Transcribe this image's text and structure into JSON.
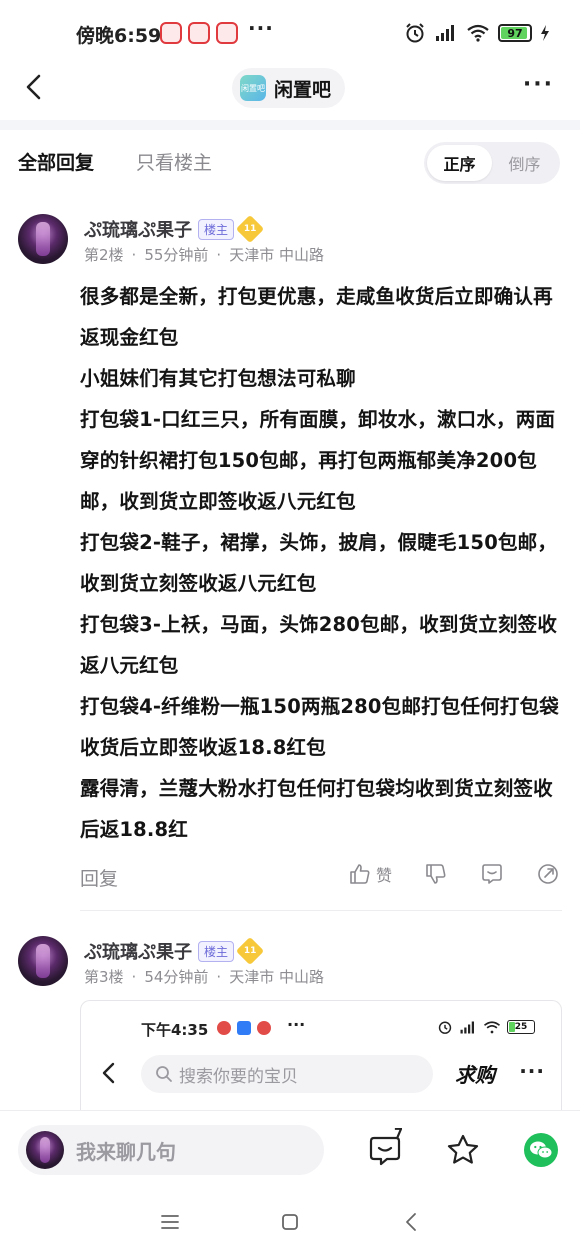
{
  "status_bar": {
    "time": "傍晚6:59",
    "dots": "···",
    "battery": "97"
  },
  "header": {
    "forum_name": "闲置吧",
    "forum_logo_text": "闲置吧",
    "more": "···"
  },
  "filter": {
    "tab_all": "全部回复",
    "tab_op_only": "只看楼主",
    "sort_asc": "正序",
    "sort_desc": "倒序"
  },
  "posts": [
    {
      "username": "ぷ琉璃ぷ果子",
      "badge": "楼主",
      "level": "11",
      "floor": "第2楼",
      "time": "55分钟前",
      "location": "天津市 中山路",
      "paragraphs": [
        "很多都是全新，打包更优惠，走咸鱼收货后立即确认再返现金红包",
        "小姐妹们有其它打包想法可私聊",
        "打包袋1-口红三只，所有面膜，卸妆水，漱口水，两面穿的针织裙打包150包邮，再打包两瓶郁美净200包邮，收到货立即签收返八元红包",
        "打包袋2-鞋子，裙撑，头饰，披肩，假睫毛150包邮，收到货立刻签收返八元红包",
        "打包袋3-上袄，马面，头饰280包邮，收到货立刻签收返八元红包",
        "打包袋4-纤维粉一瓶150两瓶280包邮打包任何打包袋收货后立即签收返18.8红包",
        "露得清，兰蔻大粉水打包任何打包袋均收到货立刻签收后返18.8红"
      ],
      "reply_label": "回复",
      "like_label": "赞"
    },
    {
      "username": "ぷ琉璃ぷ果子",
      "badge": "楼主",
      "level": "11",
      "floor": "第3楼",
      "time": "54分钟前",
      "location": "天津市 中山路"
    }
  ],
  "embedded_screenshot": {
    "time": "下午4:35",
    "dots": "···",
    "battery": "25",
    "search_placeholder": "搜索你要的宝贝",
    "buy_label": "求购",
    "more": "···"
  },
  "composer": {
    "placeholder": "我来聊几句",
    "comment_count": "7"
  },
  "colors": {
    "accent_purple": "#6c6ad8",
    "level_gold": "#f6c83a",
    "wechat_green": "#1fbf5b"
  }
}
